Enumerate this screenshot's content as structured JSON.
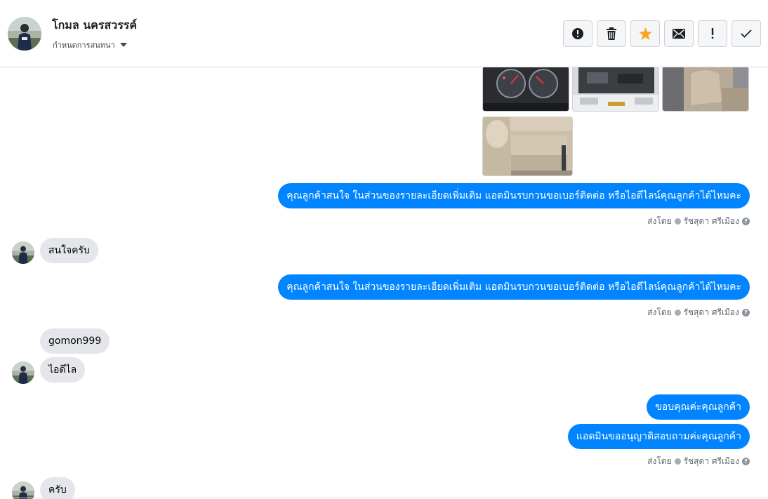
{
  "header": {
    "contact_name": "โกมล นครสวรรค์",
    "conversation_menu": "กำหนดการสนทนา",
    "actions": [
      {
        "name": "report-button",
        "icon": "alert-circle-icon"
      },
      {
        "name": "delete-button",
        "icon": "trash-icon"
      },
      {
        "name": "star-button",
        "icon": "star-icon",
        "color": "#f5a623"
      },
      {
        "name": "mark-unread-button",
        "icon": "envelope-icon"
      },
      {
        "name": "follow-up-button",
        "icon": "exclamation-icon"
      },
      {
        "name": "mark-done-button",
        "icon": "check-icon"
      }
    ]
  },
  "thread": {
    "messages": [
      {
        "direction": "out",
        "text": "คุณลูกค้าสนใจ ในส่วนของรายละเอียดเพิ่มเติม แอดมินรบกวนขอเบอร์ติดต่อ หรือไอดีไลน์คุณลูกค้าได้ไหมคะ"
      },
      {
        "direction": "in",
        "text": "สนใจครับ"
      },
      {
        "direction": "out",
        "text": "คุณลูกค้าสนใจ ในส่วนของรายละเอียดเพิ่มเติม แอดมินรบกวนขอเบอร์ติดต่อ หรือไอดีไลน์คุณลูกค้าได้ไหมคะ"
      },
      {
        "direction": "in",
        "text": "gomon999"
      },
      {
        "direction": "in",
        "text": "ไอดีไล"
      },
      {
        "direction": "out",
        "text": "ขอบคุณค่ะคุณลูกค้า"
      },
      {
        "direction": "out",
        "text": "แอดมินขออนุญาติสอบถามค่ะคุณลูกค้า"
      },
      {
        "direction": "in",
        "text": "ครับ"
      }
    ],
    "sent_by_label": "ส่งโดย",
    "sender_name": "รัชสุดา ศรีเมือง",
    "help_glyph": "?"
  },
  "colors": {
    "outgoing_bubble": "#0084ff",
    "incoming_bubble": "#e4e6eb",
    "star": "#f5a623"
  }
}
